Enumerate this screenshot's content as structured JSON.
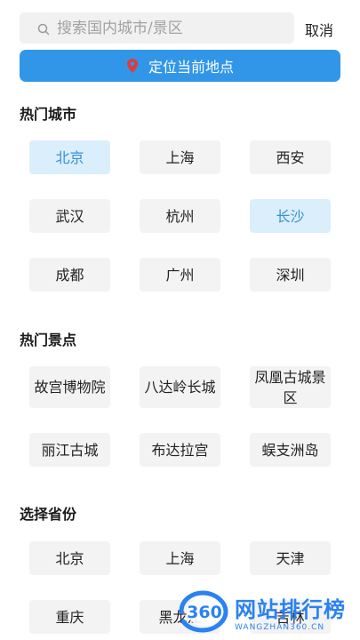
{
  "search": {
    "placeholder": "搜索国内城市/景区",
    "cancel_label": "取消"
  },
  "locate": {
    "label": "定位当前地点",
    "icon": "location-pin-icon",
    "color": "#3196e8"
  },
  "hot_cities": {
    "title": "热门城市",
    "items": [
      "北京",
      "上海",
      "西安",
      "武汉",
      "杭州",
      "长沙",
      "成都",
      "广州",
      "深圳"
    ],
    "selected": [
      "北京",
      "长沙"
    ]
  },
  "hot_spots": {
    "title": "热门景点",
    "items": [
      "故宫博物院",
      "八达岭长城",
      "凤凰古城景区",
      "丽江古城",
      "布达拉宫",
      "蜈支洲岛"
    ]
  },
  "provinces": {
    "title": "选择省份",
    "items": [
      "北京",
      "上海",
      "天津",
      "重庆",
      "黑龙江",
      "吉林"
    ]
  },
  "watermark": {
    "badge": "360",
    "title": "网站排行榜",
    "subtitle": "WANGZHAN360.CN"
  }
}
